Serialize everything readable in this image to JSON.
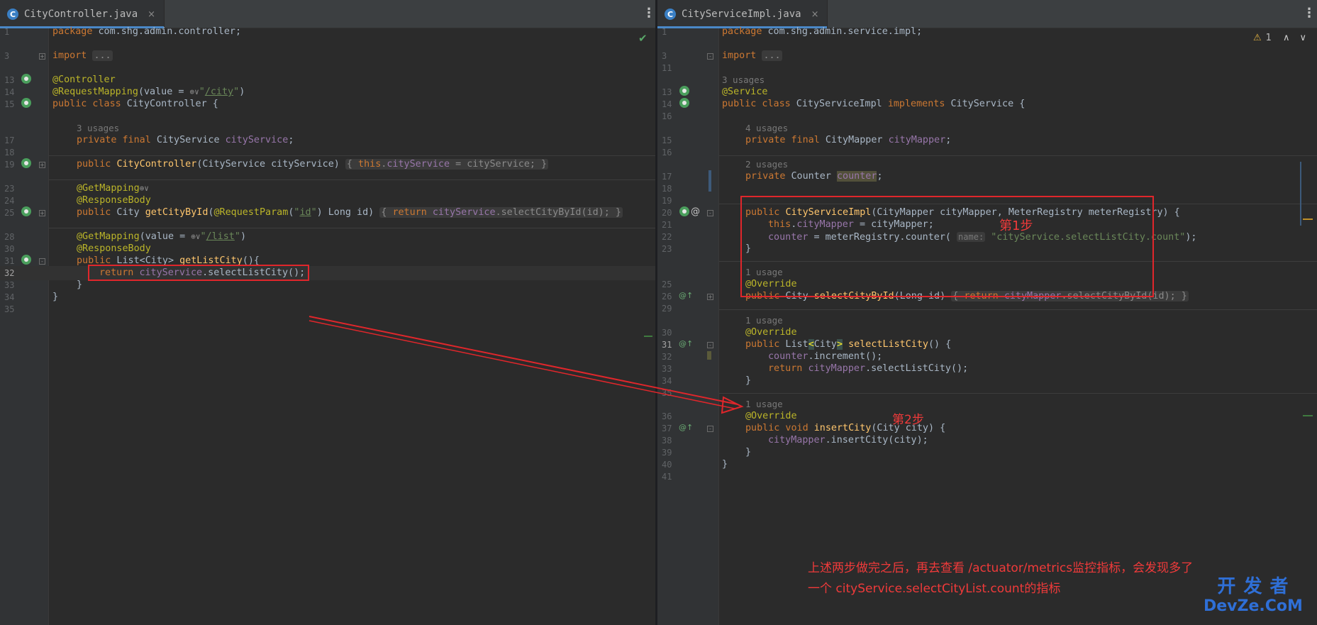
{
  "left": {
    "tab": {
      "icon": "C",
      "name": "CityController.java"
    },
    "close_glyph": "×",
    "menu_glyph": "⋮",
    "check_icon": "✔",
    "lines": [
      {
        "n": "1",
        "code": "package com.shg.admin.controller;"
      },
      {
        "n": "3",
        "code": "import ..."
      },
      {
        "n": "13",
        "code": "@Controller"
      },
      {
        "n": "14",
        "code": "@RequestMapping(value = \"/city\")"
      },
      {
        "n": "15",
        "code": "public class CityController {"
      },
      {
        "n": "",
        "code": "3 usages"
      },
      {
        "n": "17",
        "code": "private final CityService cityService;"
      },
      {
        "n": "18",
        "code": ""
      },
      {
        "n": "19",
        "code": "public CityController(CityService cityService) { this.cityService = cityService; }"
      },
      {
        "n": "23",
        "code": "@GetMapping"
      },
      {
        "n": "24",
        "code": "@ResponseBody"
      },
      {
        "n": "25",
        "code": "public City getCityById(@RequestParam(\"id\") Long id) { return cityService.selectCityById(id); }"
      },
      {
        "n": "28",
        "code": "@GetMapping(value = \"/list\")"
      },
      {
        "n": "30",
        "code": "@ResponseBody"
      },
      {
        "n": "31",
        "code": "public List<City> getListCity(){"
      },
      {
        "n": "32",
        "code": "return cityService.selectListCity();"
      },
      {
        "n": "33",
        "code": "}"
      },
      {
        "n": "34",
        "code": "}"
      },
      {
        "n": "35",
        "code": ""
      }
    ]
  },
  "right": {
    "tab": {
      "icon": "C",
      "name": "CityServiceImpl.java"
    },
    "close_glyph": "×",
    "menu_glyph": "⋮",
    "warning": {
      "icon": "⚠",
      "count": "1"
    },
    "nav_up": "∧",
    "nav_down": "∨",
    "lines": [
      {
        "n": "1",
        "code": "package com.shg.admin.service.impl;"
      },
      {
        "n": "3",
        "code": "import ..."
      },
      {
        "n": "11",
        "code": ""
      },
      {
        "n": "",
        "code": "3 usages"
      },
      {
        "n": "13",
        "code": "@Service"
      },
      {
        "n": "14",
        "code": "public class CityServiceImpl implements CityService {"
      },
      {
        "n": "16",
        "code": ""
      },
      {
        "n": "",
        "code": "4 usages"
      },
      {
        "n": "15",
        "code": "private final CityMapper cityMapper;"
      },
      {
        "n": "16",
        "code": ""
      },
      {
        "n": "",
        "code": "2 usages"
      },
      {
        "n": "17",
        "code": "private Counter counter;"
      },
      {
        "n": "18",
        "code": ""
      },
      {
        "n": "19",
        "code": ""
      },
      {
        "n": "20",
        "code": "public CityServiceImpl(CityMapper cityMapper, MeterRegistry meterRegistry) {"
      },
      {
        "n": "21",
        "code": "this.cityMapper = cityMapper;"
      },
      {
        "n": "22",
        "code": "counter = meterRegistry.counter( name: \"cityService.selectListCity.count\");"
      },
      {
        "n": "23",
        "code": "}"
      },
      {
        "n": "",
        "code": "1 usage"
      },
      {
        "n": "25",
        "code": "@Override"
      },
      {
        "n": "26",
        "code": "public City selectCityById(Long id) { return cityMapper.selectCityById(id); }"
      },
      {
        "n": "29",
        "code": ""
      },
      {
        "n": "",
        "code": "1 usage"
      },
      {
        "n": "30",
        "code": "@Override"
      },
      {
        "n": "31",
        "code": "public List<City> selectListCity() {"
      },
      {
        "n": "32",
        "code": "counter.increment();"
      },
      {
        "n": "33",
        "code": "return cityMapper.selectListCity();"
      },
      {
        "n": "34",
        "code": "}"
      },
      {
        "n": "35",
        "code": ""
      },
      {
        "n": "",
        "code": "1 usage"
      },
      {
        "n": "36",
        "code": "@Override"
      },
      {
        "n": "37",
        "code": "public void insertCity(City city) {"
      },
      {
        "n": "38",
        "code": "cityMapper.insertCity(city);"
      },
      {
        "n": "39",
        "code": "}"
      },
      {
        "n": "40",
        "code": "}"
      },
      {
        "n": "41",
        "code": ""
      }
    ]
  },
  "annotations": {
    "step1": "第1步",
    "step2": "第2步",
    "note_line1": "上述两步做完之后，再去查看 /actuator/metrics监控指标，会发现多了",
    "note_line2": "一个 cityService.selectCityList.count的指标",
    "color": "#e0262b"
  },
  "watermark": {
    "line1": "开 发 者",
    "line2": "DevZe.CoM"
  }
}
